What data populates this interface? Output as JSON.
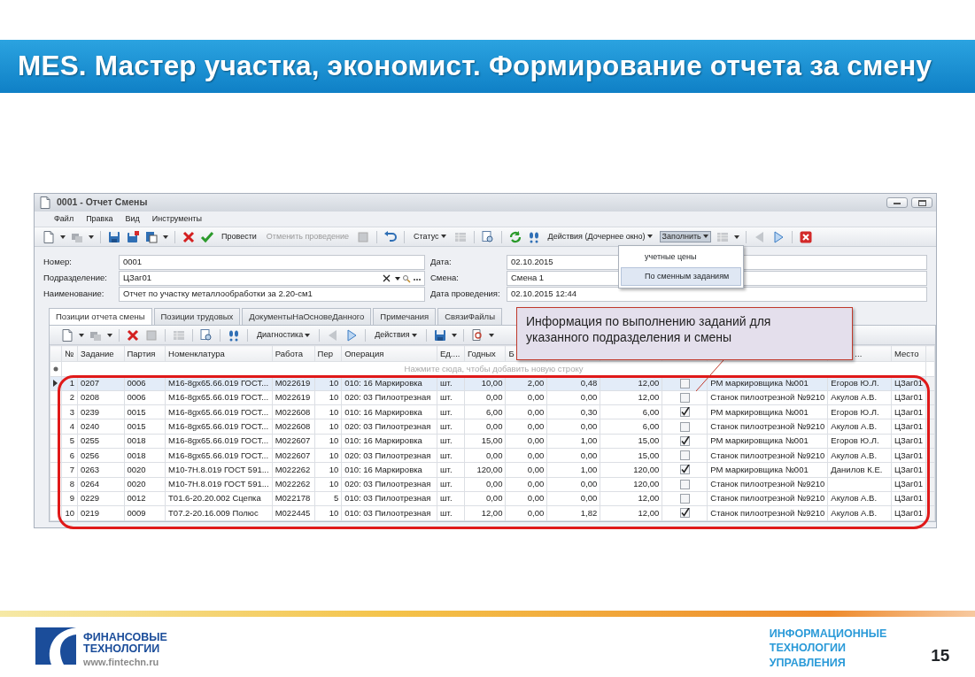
{
  "slide": {
    "title": "MES. Мастер участка, экономист. Формирование отчета за смену",
    "page_number": "15"
  },
  "window": {
    "title": "0001 - Отчет Смены"
  },
  "menu": [
    "Файл",
    "Правка",
    "Вид",
    "Инструменты"
  ],
  "toolbar": [
    {
      "label": "Провести",
      "disabled": false,
      "dropdown": false,
      "pressed": false
    },
    {
      "label": "Отменить проведение",
      "disabled": true,
      "dropdown": false,
      "pressed": false
    },
    {
      "label": "Статус",
      "disabled": false,
      "dropdown": true,
      "pressed": false
    },
    {
      "label": "Действия (Дочернее окно)",
      "disabled": false,
      "dropdown": true,
      "pressed": false
    },
    {
      "label": "Заполнить",
      "disabled": false,
      "dropdown": true,
      "pressed": true
    }
  ],
  "fill_menu": [
    {
      "label": "учетные цены",
      "selected": false
    },
    {
      "label": "По сменным заданиям",
      "selected": true
    }
  ],
  "form": [
    {
      "label": "Номер:",
      "value": "0001",
      "kind": "text"
    },
    {
      "label": "Дата:",
      "value": "02.10.2015",
      "kind": "text"
    },
    {
      "label": "Подразделение:",
      "value": "ЦЗаг01",
      "kind": "lookup"
    },
    {
      "label": "Смена:",
      "value": "Смена 1",
      "kind": "text"
    },
    {
      "label": "Наименование:",
      "value": "Отчет по участку металлообработки за 2.20-см1",
      "kind": "text"
    },
    {
      "label": "Дата проведения:",
      "value": "02.10.2015 12:44",
      "kind": "text"
    }
  ],
  "tabs": [
    {
      "label": "Позиции отчета смены",
      "selected": true
    },
    {
      "label": "Позиции трудовых",
      "selected": false
    },
    {
      "label": "ДокументыНаОсновеДанного",
      "selected": false
    },
    {
      "label": "Примечания",
      "selected": false
    },
    {
      "label": "СвязиФайлы",
      "selected": false
    }
  ],
  "grid_toolbar": [
    {
      "label": "Диагностика",
      "dropdown": true
    },
    {
      "label": "Действия",
      "dropdown": true
    }
  ],
  "table": {
    "columns": {
      "number": "№",
      "task": "Задание",
      "batch": "Партия",
      "nomenclature": "Номенклатура",
      "work": "Работа",
      "per": "Пер",
      "operation": "Операция",
      "unit": "Ед....",
      "good": "Годных",
      "column_10": "Б",
      "column_15": "...",
      "place": "Место"
    },
    "new_row_hint": "Нажмите сюда, чтобы добавить новую строку",
    "rows": [
      {
        "selected": true,
        "checked": false,
        "number": "1",
        "task": "0207",
        "batch": "0006",
        "nomenclature": "М16-8gx65.66.019 ГОСТ...",
        "work": "М022619",
        "per": "10",
        "operation": "010: 16 Маркировка",
        "unit": "шт.",
        "good": "10,00",
        "column_10": "2,00",
        "column_11": "0,48",
        "column_12": "12,00",
        "column_14": "РМ маркировщика №001",
        "column_15": "Егоров Ю.Л.",
        "place": "ЦЗаг01"
      },
      {
        "selected": false,
        "checked": false,
        "number": "2",
        "task": "0208",
        "batch": "0006",
        "nomenclature": "М16-8gx65.66.019 ГОСТ...",
        "work": "М022619",
        "per": "10",
        "operation": "020: 03 Пилоотрезная",
        "unit": "шт.",
        "good": "0,00",
        "column_10": "0,00",
        "column_11": "0,00",
        "column_12": "12,00",
        "column_14": "Станок пилоотрезной №9210",
        "column_15": "Акулов А.В.",
        "place": "ЦЗаг01"
      },
      {
        "selected": false,
        "checked": true,
        "number": "3",
        "task": "0239",
        "batch": "0015",
        "nomenclature": "М16-8gx65.66.019 ГОСТ...",
        "work": "М022608",
        "per": "10",
        "operation": "010: 16 Маркировка",
        "unit": "шт.",
        "good": "6,00",
        "column_10": "0,00",
        "column_11": "0,30",
        "column_12": "6,00",
        "column_14": "РМ маркировщика №001",
        "column_15": "Егоров Ю.Л.",
        "place": "ЦЗаг01"
      },
      {
        "selected": false,
        "checked": false,
        "number": "4",
        "task": "0240",
        "batch": "0015",
        "nomenclature": "М16-8gx65.66.019 ГОСТ...",
        "work": "М022608",
        "per": "10",
        "operation": "020: 03 Пилоотрезная",
        "unit": "шт.",
        "good": "0,00",
        "column_10": "0,00",
        "column_11": "0,00",
        "column_12": "6,00",
        "column_14": "Станок пилоотрезной №9210",
        "column_15": "Акулов А.В.",
        "place": "ЦЗаг01"
      },
      {
        "selected": false,
        "checked": true,
        "number": "5",
        "task": "0255",
        "batch": "0018",
        "nomenclature": "М16-8gx65.66.019 ГОСТ...",
        "work": "М022607",
        "per": "10",
        "operation": "010: 16 Маркировка",
        "unit": "шт.",
        "good": "15,00",
        "column_10": "0,00",
        "column_11": "1,00",
        "column_12": "15,00",
        "column_14": "РМ маркировщика №001",
        "column_15": "Егоров Ю.Л.",
        "place": "ЦЗаг01"
      },
      {
        "selected": false,
        "checked": false,
        "number": "6",
        "task": "0256",
        "batch": "0018",
        "nomenclature": "М16-8gx65.66.019 ГОСТ...",
        "work": "М022607",
        "per": "10",
        "operation": "020: 03 Пилоотрезная",
        "unit": "шт.",
        "good": "0,00",
        "column_10": "0,00",
        "column_11": "0,00",
        "column_12": "15,00",
        "column_14": "Станок пилоотрезной №9210",
        "column_15": "Акулов А.В.",
        "place": "ЦЗаг01"
      },
      {
        "selected": false,
        "checked": true,
        "number": "7",
        "task": "0263",
        "batch": "0020",
        "nomenclature": "М10-7H.8.019 ГОСТ 591...",
        "work": "М022262",
        "per": "10",
        "operation": "010: 16 Маркировка",
        "unit": "шт.",
        "good": "120,00",
        "column_10": "0,00",
        "column_11": "1,00",
        "column_12": "120,00",
        "column_14": "РМ маркировщика №001",
        "column_15": "Данилов К.Е.",
        "place": "ЦЗаг01"
      },
      {
        "selected": false,
        "checked": false,
        "number": "8",
        "task": "0264",
        "batch": "0020",
        "nomenclature": "М10-7H.8.019 ГОСТ 591...",
        "work": "М022262",
        "per": "10",
        "operation": "020: 03 Пилоотрезная",
        "unit": "шт.",
        "good": "0,00",
        "column_10": "0,00",
        "column_11": "0,00",
        "column_12": "120,00",
        "column_14": "Станок пилоотрезной №9210",
        "place": "ЦЗаг01"
      },
      {
        "selected": false,
        "checked": false,
        "number": "9",
        "task": "0229",
        "batch": "0012",
        "nomenclature": "Т01.6-20.20.002 Сцепка",
        "work": "М022178",
        "per": "5",
        "operation": "010: 03 Пилоотрезная",
        "unit": "шт.",
        "good": "0,00",
        "column_10": "0,00",
        "column_11": "0,00",
        "column_12": "12,00",
        "column_14": "Станок пилоотрезной №9210",
        "column_15": "Акулов А.В.",
        "place": "ЦЗаг01"
      },
      {
        "selected": false,
        "checked": true,
        "number": "10",
        "task": "0219",
        "batch": "0009",
        "nomenclature": "Т07.2-20.16.009 Полюс",
        "work": "М022445",
        "per": "10",
        "operation": "010: 03 Пилоотрезная",
        "unit": "шт.",
        "good": "12,00",
        "column_10": "0,00",
        "column_11": "1,82",
        "column_12": "12,00",
        "column_14": "Станок пилоотрезной №9210",
        "column_15": "Акулов А.В.",
        "place": "ЦЗаг01"
      }
    ]
  },
  "callout": {
    "text": "Информация по выполнению заданий для указанного подразделения и смены"
  },
  "footer": {
    "company": [
      "ФИНАНСОВЫЕ",
      "ТЕХНОЛОГИИ"
    ],
    "website": "www.fintechn.ru",
    "tagline": [
      "ИНФОРМАЦИОННЫЕ",
      "ТЕХНОЛОГИИ",
      "УПРАВЛЕНИЯ"
    ]
  }
}
